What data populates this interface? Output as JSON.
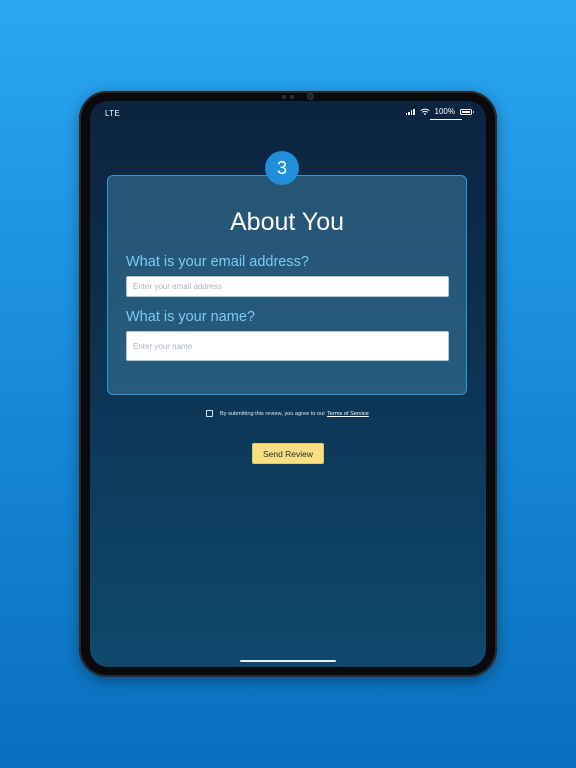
{
  "status_bar": {
    "carrier": "LTE",
    "battery_percent": "100%"
  },
  "card": {
    "step_number": "3",
    "title": "About You",
    "email_label": "What is your email address?",
    "email_placeholder": "Enter your email address",
    "email_value": "",
    "name_label": "What is your name?",
    "name_placeholder": "Enter your name",
    "name_value": ""
  },
  "terms": {
    "checked": false,
    "text": "By submitting this review, you agree to our",
    "link_text": "Terms of Service"
  },
  "actions": {
    "send_label": "Send Review"
  },
  "colors": {
    "background_accent": "#1e8fd8",
    "card_border": "#2a9adf",
    "label_color": "#78ccf5",
    "button_fill": "#f9df84"
  },
  "icons": [
    "signal-icon",
    "wifi-icon",
    "battery-icon"
  ]
}
